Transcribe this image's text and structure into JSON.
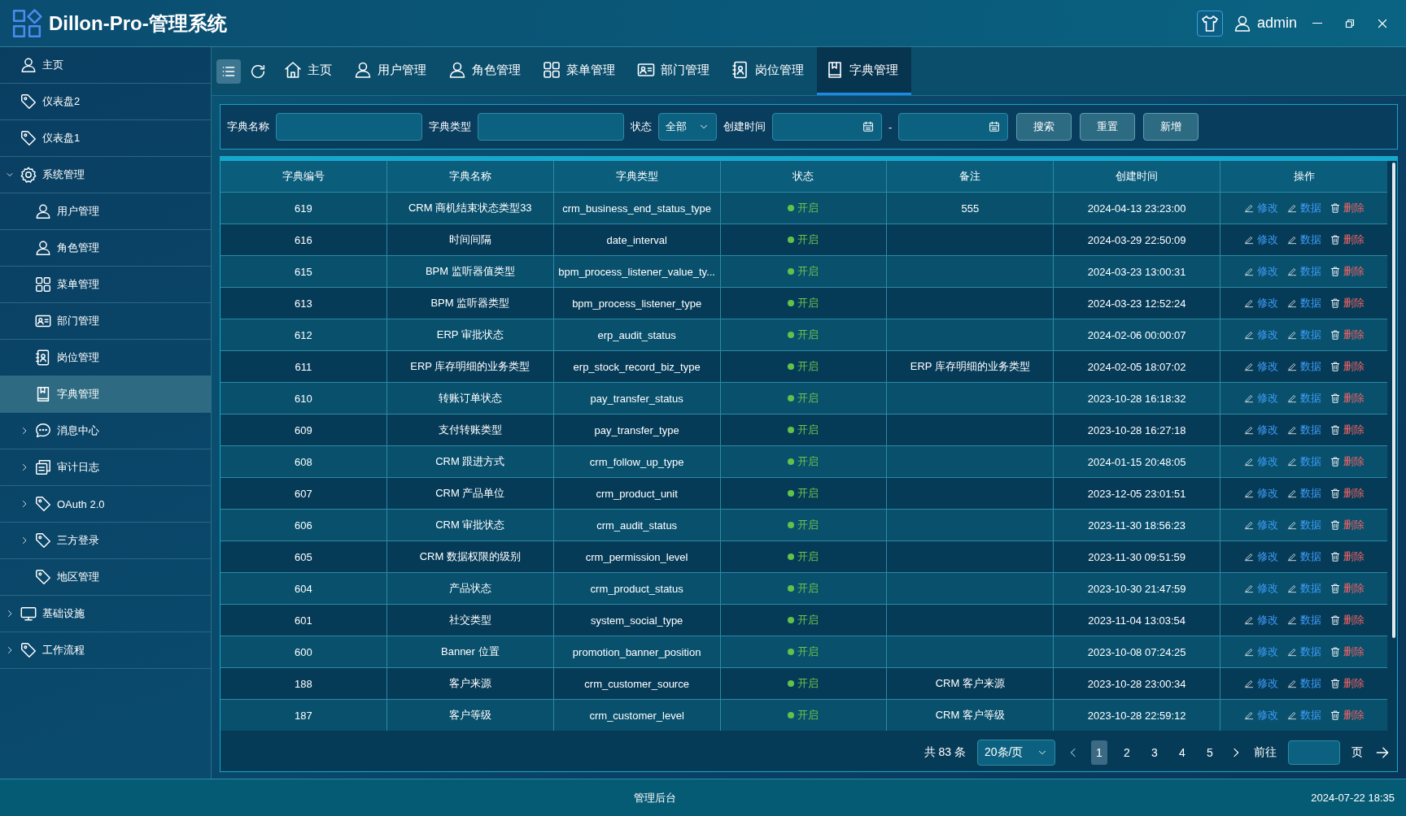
{
  "app": {
    "title": "Dillon-Pro-管理系统",
    "user": "admin"
  },
  "sidebar": {
    "items": [
      {
        "label": "主页",
        "selected": false
      },
      {
        "label": "仪表盘2",
        "selected": false
      },
      {
        "label": "仪表盘1",
        "selected": false
      },
      {
        "label": "系统管理",
        "selected": false,
        "expanded": true,
        "children": [
          {
            "label": "用户管理",
            "selected": false
          },
          {
            "label": "角色管理",
            "selected": false
          },
          {
            "label": "菜单管理",
            "selected": false
          },
          {
            "label": "部门管理",
            "selected": false
          },
          {
            "label": "岗位管理",
            "selected": false
          },
          {
            "label": "字典管理",
            "selected": true
          },
          {
            "label": "消息中心",
            "selected": false,
            "expanded": false
          },
          {
            "label": "审计日志",
            "selected": false,
            "expanded": false
          },
          {
            "label": "OAuth 2.0",
            "selected": false,
            "expanded": false
          },
          {
            "label": "三方登录",
            "selected": false,
            "expanded": false
          },
          {
            "label": "地区管理",
            "selected": false
          }
        ]
      },
      {
        "label": "基础设施",
        "selected": false,
        "expanded": false
      },
      {
        "label": "工作流程",
        "selected": false,
        "expanded": false
      }
    ]
  },
  "tabs": [
    {
      "label": "主页",
      "selected": false
    },
    {
      "label": "用户管理",
      "selected": false
    },
    {
      "label": "角色管理",
      "selected": false
    },
    {
      "label": "菜单管理",
      "selected": false
    },
    {
      "label": "部门管理",
      "selected": false
    },
    {
      "label": "岗位管理",
      "selected": false
    },
    {
      "label": "字典管理",
      "selected": true
    }
  ],
  "filters": {
    "name_label": "字典名称",
    "type_label": "字典类型",
    "status_label": "状态",
    "status_value": "全部",
    "time_label": "创建时间",
    "range_separator": "-",
    "buttons": [
      "搜索",
      "重置",
      "新增"
    ]
  },
  "table": {
    "columns": [
      "字典编号",
      "字典名称",
      "字典类型",
      "状态",
      "备注",
      "创建时间",
      "操作"
    ],
    "rows": [
      {
        "id": "619",
        "name": "CRM 商机结束状态类型33",
        "type": "crm_business_end_status_type",
        "status": "开启",
        "remark": "555",
        "created": "2024-04-13 23:23:00",
        "actions": [
          "修改",
          "数据",
          "删除"
        ]
      },
      {
        "id": "616",
        "name": "时间间隔",
        "type": "date_interval",
        "status": "开启",
        "remark": "",
        "created": "2024-03-29 22:50:09",
        "actions": [
          "修改",
          "数据",
          "删除"
        ]
      },
      {
        "id": "615",
        "name": "BPM 监听器值类型",
        "type": "bpm_process_listener_value_ty...",
        "status": "开启",
        "remark": "",
        "created": "2024-03-23 13:00:31",
        "actions": [
          "修改",
          "数据",
          "删除"
        ]
      },
      {
        "id": "613",
        "name": "BPM 监听器类型",
        "type": "bpm_process_listener_type",
        "status": "开启",
        "remark": "",
        "created": "2024-03-23 12:52:24",
        "actions": [
          "修改",
          "数据",
          "删除"
        ]
      },
      {
        "id": "612",
        "name": "ERP 审批状态",
        "type": "erp_audit_status",
        "status": "开启",
        "remark": "",
        "created": "2024-02-06 00:00:07",
        "actions": [
          "修改",
          "数据",
          "删除"
        ]
      },
      {
        "id": "611",
        "name": "ERP 库存明细的业务类型",
        "type": "erp_stock_record_biz_type",
        "status": "开启",
        "remark": "ERP 库存明细的业务类型",
        "created": "2024-02-05 18:07:02",
        "actions": [
          "修改",
          "数据",
          "删除"
        ]
      },
      {
        "id": "610",
        "name": "转账订单状态",
        "type": "pay_transfer_status",
        "status": "开启",
        "remark": "",
        "created": "2023-10-28 16:18:32",
        "actions": [
          "修改",
          "数据",
          "删除"
        ]
      },
      {
        "id": "609",
        "name": "支付转账类型",
        "type": "pay_transfer_type",
        "status": "开启",
        "remark": "",
        "created": "2023-10-28 16:27:18",
        "actions": [
          "修改",
          "数据",
          "删除"
        ]
      },
      {
        "id": "608",
        "name": "CRM 跟进方式",
        "type": "crm_follow_up_type",
        "status": "开启",
        "remark": "",
        "created": "2024-01-15 20:48:05",
        "actions": [
          "修改",
          "数据",
          "删除"
        ]
      },
      {
        "id": "607",
        "name": "CRM 产品单位",
        "type": "crm_product_unit",
        "status": "开启",
        "remark": "",
        "created": "2023-12-05 23:01:51",
        "actions": [
          "修改",
          "数据",
          "删除"
        ]
      },
      {
        "id": "606",
        "name": "CRM 审批状态",
        "type": "crm_audit_status",
        "status": "开启",
        "remark": "",
        "created": "2023-11-30 18:56:23",
        "actions": [
          "修改",
          "数据",
          "删除"
        ]
      },
      {
        "id": "605",
        "name": "CRM 数据权限的级别",
        "type": "crm_permission_level",
        "status": "开启",
        "remark": "",
        "created": "2023-11-30 09:51:59",
        "actions": [
          "修改",
          "数据",
          "删除"
        ]
      },
      {
        "id": "604",
        "name": "产品状态",
        "type": "crm_product_status",
        "status": "开启",
        "remark": "",
        "created": "2023-10-30 21:47:59",
        "actions": [
          "修改",
          "数据",
          "删除"
        ]
      },
      {
        "id": "601",
        "name": "社交类型",
        "type": "system_social_type",
        "status": "开启",
        "remark": "",
        "created": "2023-11-04 13:03:54",
        "actions": [
          "修改",
          "数据",
          "删除"
        ]
      },
      {
        "id": "600",
        "name": "Banner 位置",
        "type": "promotion_banner_position",
        "status": "开启",
        "remark": "",
        "created": "2023-10-08 07:24:25",
        "actions": [
          "修改",
          "数据",
          "删除"
        ]
      },
      {
        "id": "188",
        "name": "客户来源",
        "type": "crm_customer_source",
        "status": "开启",
        "remark": "CRM 客户来源",
        "created": "2023-10-28 23:00:34",
        "actions": [
          "修改",
          "数据",
          "删除"
        ]
      },
      {
        "id": "187",
        "name": "客户等级",
        "type": "crm_customer_level",
        "status": "开启",
        "remark": "CRM 客户等级",
        "created": "2023-10-28 22:59:12",
        "actions": [
          "修改",
          "数据",
          "删除"
        ]
      }
    ]
  },
  "pagination": {
    "total": "共 83 条",
    "page_size": "20条/页",
    "pages": [
      {
        "label": "1",
        "selected": true
      },
      {
        "label": "2",
        "selected": false
      },
      {
        "label": "3",
        "selected": false
      },
      {
        "label": "4",
        "selected": false
      },
      {
        "label": "5",
        "selected": false
      }
    ],
    "goto_label": "前往",
    "page_suffix": "页"
  },
  "footer": {
    "center": "管理后台",
    "time": "2024-07-22 18:35"
  }
}
